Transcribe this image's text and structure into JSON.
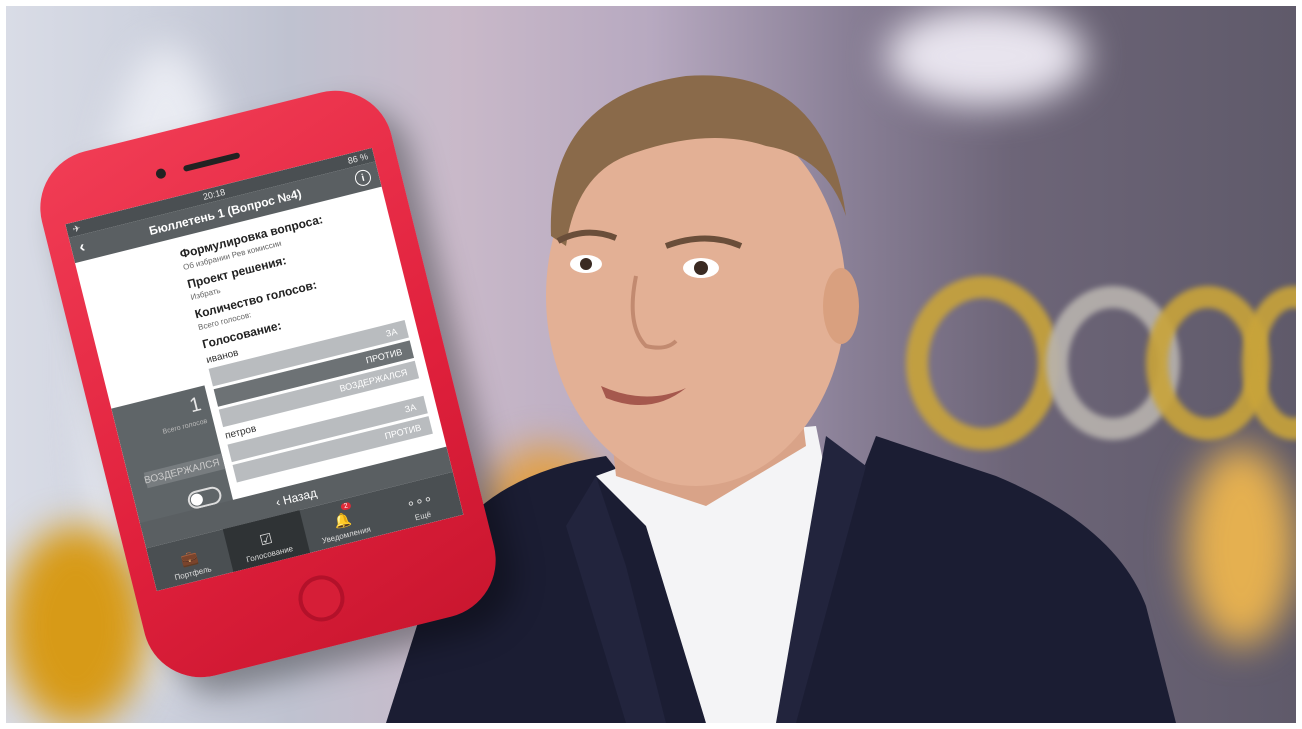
{
  "phone": {
    "status": {
      "time": "20:18",
      "battery": "86 %"
    },
    "nav": {
      "title": "Бюллетень 1 (Вопрос №4)"
    },
    "sections": [
      {
        "title": "Формулировка вопроса:",
        "text": "Об избрании Рев комиссии"
      },
      {
        "title": "Проект решения:",
        "text": "Избрать"
      },
      {
        "title": "Количество голосов:",
        "text": "Всего голосов:"
      },
      {
        "title": "Голосование:",
        "text": ""
      }
    ],
    "side_panel": {
      "count": "1",
      "caption": "Всего голосов",
      "abstain_label": "ВОЗДЕРЖАЛСЯ"
    },
    "voters": [
      {
        "name": "иванов",
        "options": [
          "ЗА",
          "ПРОТИВ",
          "ВОЗДЕРЖАЛСЯ"
        ],
        "selected": "ПРОТИВ"
      },
      {
        "name": "петров",
        "options": [
          "ЗА",
          "ПРОТИВ"
        ],
        "selected": ""
      }
    ],
    "back_label": "‹ Назад",
    "tabs": [
      {
        "label": "Портфель",
        "icon": "briefcase-icon"
      },
      {
        "label": "Голосование",
        "icon": "checkbox-icon"
      },
      {
        "label": "Уведомления",
        "icon": "bell-icon",
        "badge": "2"
      },
      {
        "label": "Ещё",
        "icon": "more-icon"
      }
    ],
    "active_tab": "Голосование"
  },
  "colors": {
    "phone": "#e0203c",
    "header": "#5a5f62",
    "button": "#b9bcbf"
  }
}
